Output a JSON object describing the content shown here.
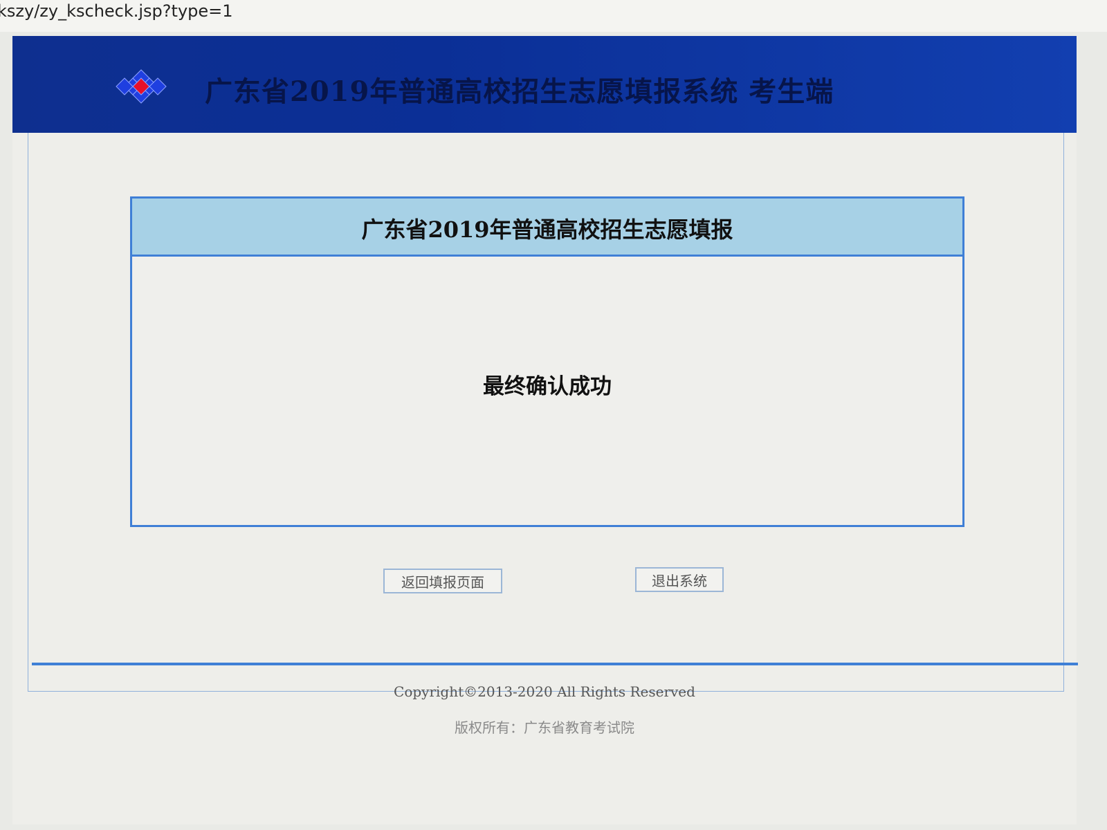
{
  "browser": {
    "url": "kszy/zy_kscheck.jsp?type=1"
  },
  "header": {
    "title": "广东省2019年普通高校招生志愿填报系统  考生端"
  },
  "panel": {
    "title": "广东省2019年普通高校招生志愿填报",
    "message": "最终确认成功"
  },
  "buttons": {
    "return_label": "返回填报页面",
    "exit_label": "退出系统"
  },
  "footer": {
    "copyright": "Copyright©2013-2020  All Rights Reserved",
    "owner": "版权所有：广东省教育考试院"
  },
  "colors": {
    "header_bg": "#0e2f8f",
    "panel_header_bg": "#a7d1e6",
    "border_blue": "#3f7fd6",
    "logo_blue": "#1f3fe0",
    "logo_red": "#e8102a"
  }
}
